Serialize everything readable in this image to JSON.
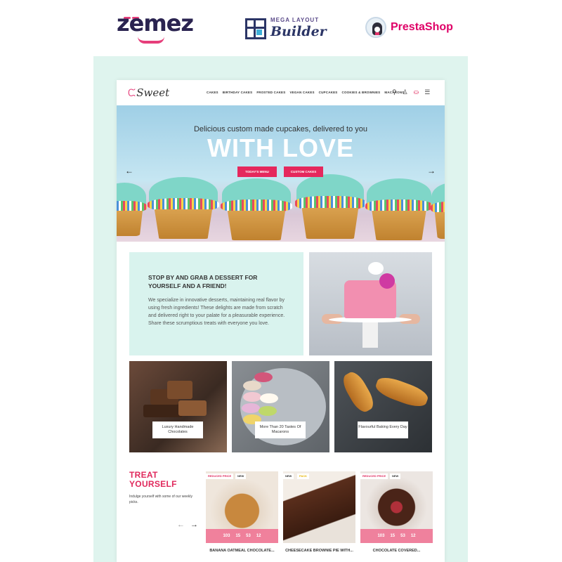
{
  "banner": {
    "zemez": "zemez",
    "mlb_title": "MEGA LAYOUT",
    "mlb_sub": "Builder",
    "presta": "PrestaShop"
  },
  "nav": {
    "brand": "Sweet",
    "menu": [
      "CAKES",
      "BIRTHDAY CAKES",
      "FROSTED CAKES",
      "VEGAN CAKES",
      "CUPCAKES",
      "COOKIES & BROWNIES",
      "MACARONS"
    ],
    "icons": [
      "search-icon",
      "user-icon",
      "cart-icon",
      "menu-icon"
    ]
  },
  "hero": {
    "subtitle": "Delicious custom made cupcakes, delivered to you",
    "title": "WITH LOVE",
    "btn_menu": "TODAY'S MENU",
    "btn_custom": "CUSTOM CAKES",
    "prev": "←",
    "next": "→"
  },
  "promo": {
    "heading": "STOP BY AND GRAB A DESSERT FOR YOURSELF AND A FRIEND!",
    "body": "We specialize in innovative desserts, maintaining real flavor by using fresh ingredients! These delights are made from scratch and delivered right to your palate for a pleasurable experience. Share these scrumptious treats with everyone you love."
  },
  "tiles": [
    {
      "label": "Luxury Handmade Chocolates"
    },
    {
      "label": "More Than 20 Tastes Of Macarons"
    },
    {
      "label": "Flavourful Baking Every Day"
    }
  ],
  "treat": {
    "heading_1": "TREAT",
    "heading_2": "YOURSELF",
    "text": "Indulge yourself with some of our weekly picks.",
    "prev": "←",
    "next": "→"
  },
  "products": [
    {
      "name": "BANANA OATMEAL CHOCOLATE...",
      "badges": [
        "REDUCED PRICE",
        "NEW"
      ],
      "countdown": [
        "103",
        "15",
        "53",
        "12"
      ]
    },
    {
      "name": "CHEESECAKE BROWNIE PIE WITH...",
      "badges": [
        "NEW",
        "PACK"
      ],
      "countdown": []
    },
    {
      "name": "CHOCOLATE COVERED...",
      "badges": [
        "REDUCED PRICE",
        "NEW"
      ],
      "countdown": [
        "103",
        "15",
        "53",
        "12"
      ]
    }
  ],
  "colors": {
    "accent": "#e0295c",
    "mint": "#dff4ee",
    "hero_button": "#e5285d"
  }
}
